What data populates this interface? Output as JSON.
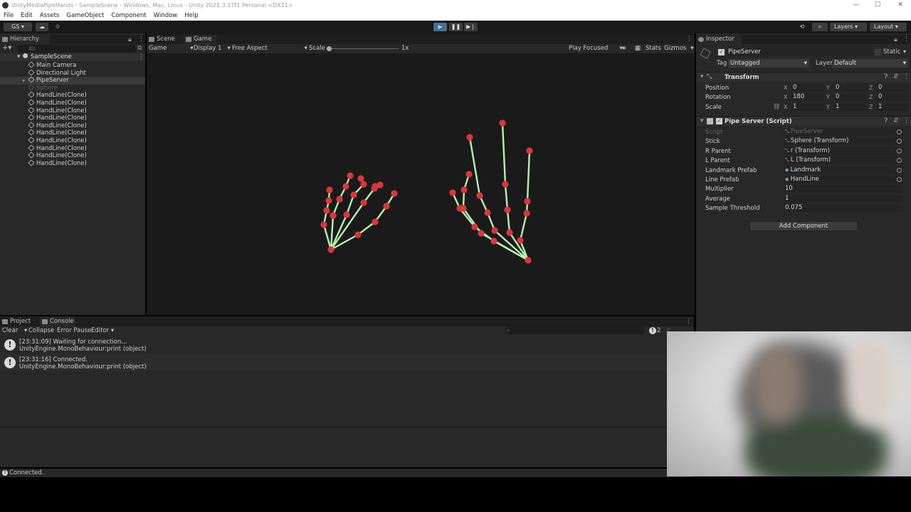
{
  "window": {
    "title": "UnityMediaPipeHands - SampleScene - Windows, Mac, Linux - Unity 2021.3.17f1 Personal <DX11>"
  },
  "menu": [
    "File",
    "Edit",
    "Assets",
    "GameObject",
    "Component",
    "Window",
    "Help"
  ],
  "toolbar": {
    "account": "GS",
    "layers": "Layers",
    "layout": "Layout"
  },
  "hierarchy": {
    "tab": "Hierarchy",
    "search_placeholder": "All",
    "scene": "SampleScene",
    "items": [
      {
        "label": "Main Camera",
        "dim": false
      },
      {
        "label": "Directional Light",
        "dim": false
      },
      {
        "label": "PipeServer",
        "dim": false,
        "selected": true
      },
      {
        "label": "Sphere",
        "dim": true
      },
      {
        "label": "HandLine(Clone)",
        "dim": false
      },
      {
        "label": "HandLine(Clone)",
        "dim": false
      },
      {
        "label": "HandLine(Clone)",
        "dim": false
      },
      {
        "label": "HandLine(Clone)",
        "dim": false
      },
      {
        "label": "HandLine(Clone)",
        "dim": false
      },
      {
        "label": "HandLine(Clone)",
        "dim": false
      },
      {
        "label": "HandLine(Clone)",
        "dim": false
      },
      {
        "label": "HandLine(Clone)",
        "dim": false
      },
      {
        "label": "HandLine(Clone)",
        "dim": false
      },
      {
        "label": "HandLine(Clone)",
        "dim": false
      }
    ]
  },
  "game_view": {
    "tabs": [
      "Scene",
      "Game"
    ],
    "mode": "Game",
    "display": "Display 1",
    "aspect": "Free Aspect",
    "scale_label": "Scale",
    "scale_value": "1x",
    "play_focused": "Play Focused",
    "stats": "Stats",
    "gizmos": "Gizmos"
  },
  "inspector": {
    "tab": "Inspector",
    "object_name": "PipeServer",
    "static_label": "Static",
    "tag_label": "Tag",
    "tag_value": "Untagged",
    "layer_label": "Layer",
    "layer_value": "Default",
    "transform": {
      "title": "Transform",
      "position_label": "Position",
      "rotation_label": "Rotation",
      "scale_label": "Scale",
      "position": {
        "x": "0",
        "y": "0",
        "z": "0"
      },
      "rotation": {
        "x": "180",
        "y": "0",
        "z": "0"
      },
      "scale": {
        "x": "1",
        "y": "1",
        "z": "1"
      }
    },
    "script": {
      "title": "Pipe Server (Script)",
      "fields": [
        {
          "label": "Script",
          "value": "PipeServer",
          "dim": true
        },
        {
          "label": "Stick",
          "value": "Sphere (Transform)"
        },
        {
          "label": "R Parent",
          "value": "r (Transform)"
        },
        {
          "label": "L Parent",
          "value": "L (Transform)"
        },
        {
          "label": "Landmark Prefab",
          "value": "Landmark"
        },
        {
          "label": "Line Prefab",
          "value": "HandLine"
        },
        {
          "label": "Multiplier",
          "value": "10"
        },
        {
          "label": "Average",
          "value": "1"
        },
        {
          "label": "Sample Threshold",
          "value": "0.075"
        }
      ]
    },
    "add_component": "Add Component"
  },
  "console": {
    "tabs": [
      "Project",
      "Console"
    ],
    "buttons": [
      "Clear",
      "Collapse",
      "Error Pause",
      "Editor"
    ],
    "count": "2",
    "logs": [
      {
        "line1": "[23:31:09] Waiting for connection...",
        "line2": "UnityEngine.MonoBehaviour:print (object)"
      },
      {
        "line1": "[23:31:16] Connected.",
        "line2": "UnityEngine.MonoBehaviour:print (object)"
      }
    ]
  },
  "status_bar": {
    "text": "Connected."
  },
  "colors": {
    "joint": "#d9363e",
    "bone": "#b8f0b0",
    "selection": "#2c5d87"
  },
  "icons": [
    "play-icon",
    "pause-icon",
    "step-icon",
    "search-icon",
    "history-icon",
    "lock-icon",
    "more-icon",
    "info-icon",
    "settings-icon",
    "cube-icon",
    "warning-icon"
  ]
}
